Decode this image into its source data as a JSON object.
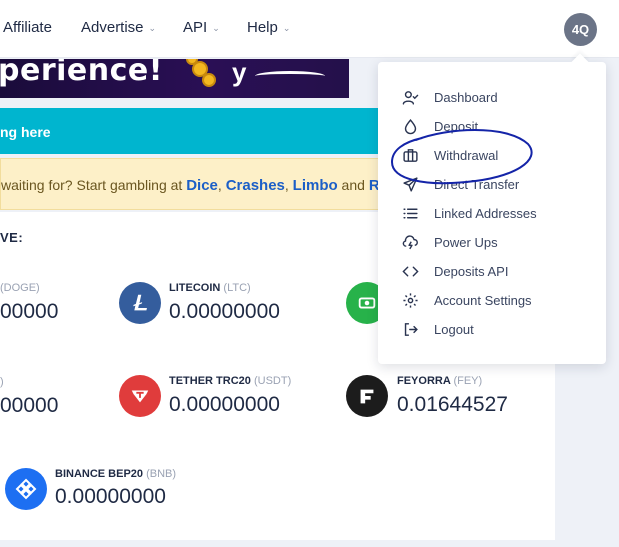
{
  "nav": {
    "items": [
      {
        "label": "Affiliate",
        "dropdown": false
      },
      {
        "label": "Advertise",
        "dropdown": true
      },
      {
        "label": "API",
        "dropdown": true
      },
      {
        "label": "Help",
        "dropdown": true
      }
    ],
    "avatar_initials": "4Q"
  },
  "banner": {
    "text": "perience!",
    "trail": "y"
  },
  "cyan_bar": {
    "prefix": "ng ",
    "link": "here"
  },
  "alert": {
    "prefix": "waiting for? Start gambling at ",
    "links": [
      "Dice",
      "Crashes",
      "Limbo",
      "R"
    ],
    "sep1": ", ",
    "sep2": ", ",
    "sep3": " and "
  },
  "balances": {
    "title": "VE:",
    "coins": [
      {
        "name": "",
        "ticker": "(DOGE)",
        "amount": "00000",
        "color": "#c2a633",
        "icon": "doge-icon"
      },
      {
        "name": "LITECOIN",
        "ticker": "(LTC)",
        "amount": "0.00000000",
        "color": "#345d9d",
        "icon": "litecoin-icon"
      },
      {
        "name": "",
        "ticker": "",
        "amount": "",
        "color": "#27b24a",
        "icon": "green-coin-icon"
      },
      {
        "name": "",
        "ticker": ")",
        "amount": "00000",
        "color": "#aaaaaa",
        "icon": "partial-coin-icon"
      },
      {
        "name": "TETHER TRC20",
        "ticker": "(USDT)",
        "amount": "0.00000000",
        "color": "#e03c3c",
        "icon": "tether-trc20-icon"
      },
      {
        "name": "FEYORRA",
        "ticker": "(FEY)",
        "amount": "0.01644527",
        "color": "#1c1c1c",
        "icon": "feyorra-icon"
      },
      {
        "name": "BINANCE BEP20",
        "ticker": "(BNB)",
        "amount": "0.00000000",
        "color": "#1d6ff2",
        "icon": "binance-icon"
      }
    ]
  },
  "dropdown": {
    "items": [
      {
        "label": "Dashboard",
        "icon": "user-check-icon"
      },
      {
        "label": "Deposit",
        "icon": "droplet-icon"
      },
      {
        "label": "Withdrawal",
        "icon": "briefcase-icon"
      },
      {
        "label": "Direct Transfer",
        "icon": "send-icon"
      },
      {
        "label": "Linked Addresses",
        "icon": "list-icon"
      },
      {
        "label": "Power Ups",
        "icon": "cloud-lightning-icon"
      },
      {
        "label": "Deposits API",
        "icon": "code-icon"
      },
      {
        "label": "Account Settings",
        "icon": "gear-icon"
      },
      {
        "label": "Logout",
        "icon": "logout-icon"
      }
    ]
  },
  "colors": {
    "accent_cyan": "#00b5cf",
    "link_blue": "#1c5fc7",
    "annotation": "#1424a8"
  }
}
